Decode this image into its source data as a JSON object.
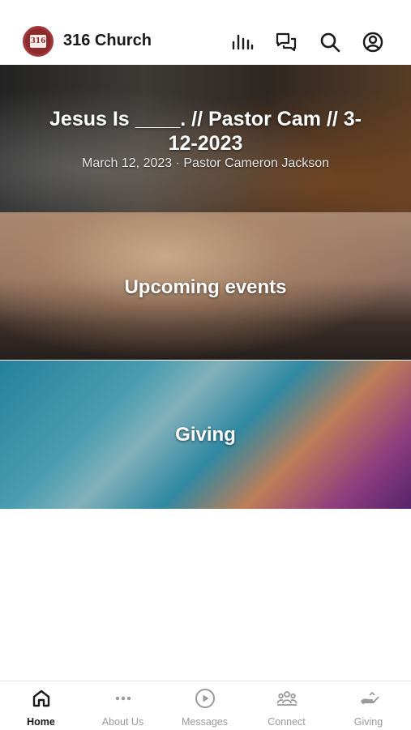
{
  "header": {
    "app_title": "316 Church",
    "logo_text": "316",
    "icons": [
      "equalizer-icon",
      "chat-bubbles-icon",
      "search-icon",
      "account-icon"
    ]
  },
  "banners": [
    {
      "title": "Jesus Is ____. // Pastor Cam // 3-12-2023",
      "subtitle": "March 12, 2023 · Pastor Cameron Jackson"
    },
    {
      "title": "Upcoming events"
    },
    {
      "title": "Giving"
    }
  ],
  "tabs": [
    {
      "label": "Home",
      "icon": "home-icon",
      "active": true
    },
    {
      "label": "About Us",
      "icon": "more-dots-icon",
      "active": false
    },
    {
      "label": "Messages",
      "icon": "play-circle-icon",
      "active": false
    },
    {
      "label": "Connect",
      "icon": "people-icon",
      "active": false
    },
    {
      "label": "Giving",
      "icon": "giving-hand-icon",
      "active": false
    }
  ],
  "colors": {
    "accent": "#1a1a1a",
    "inactive": "#9a9a9a",
    "brand": "#8c2a2e"
  }
}
